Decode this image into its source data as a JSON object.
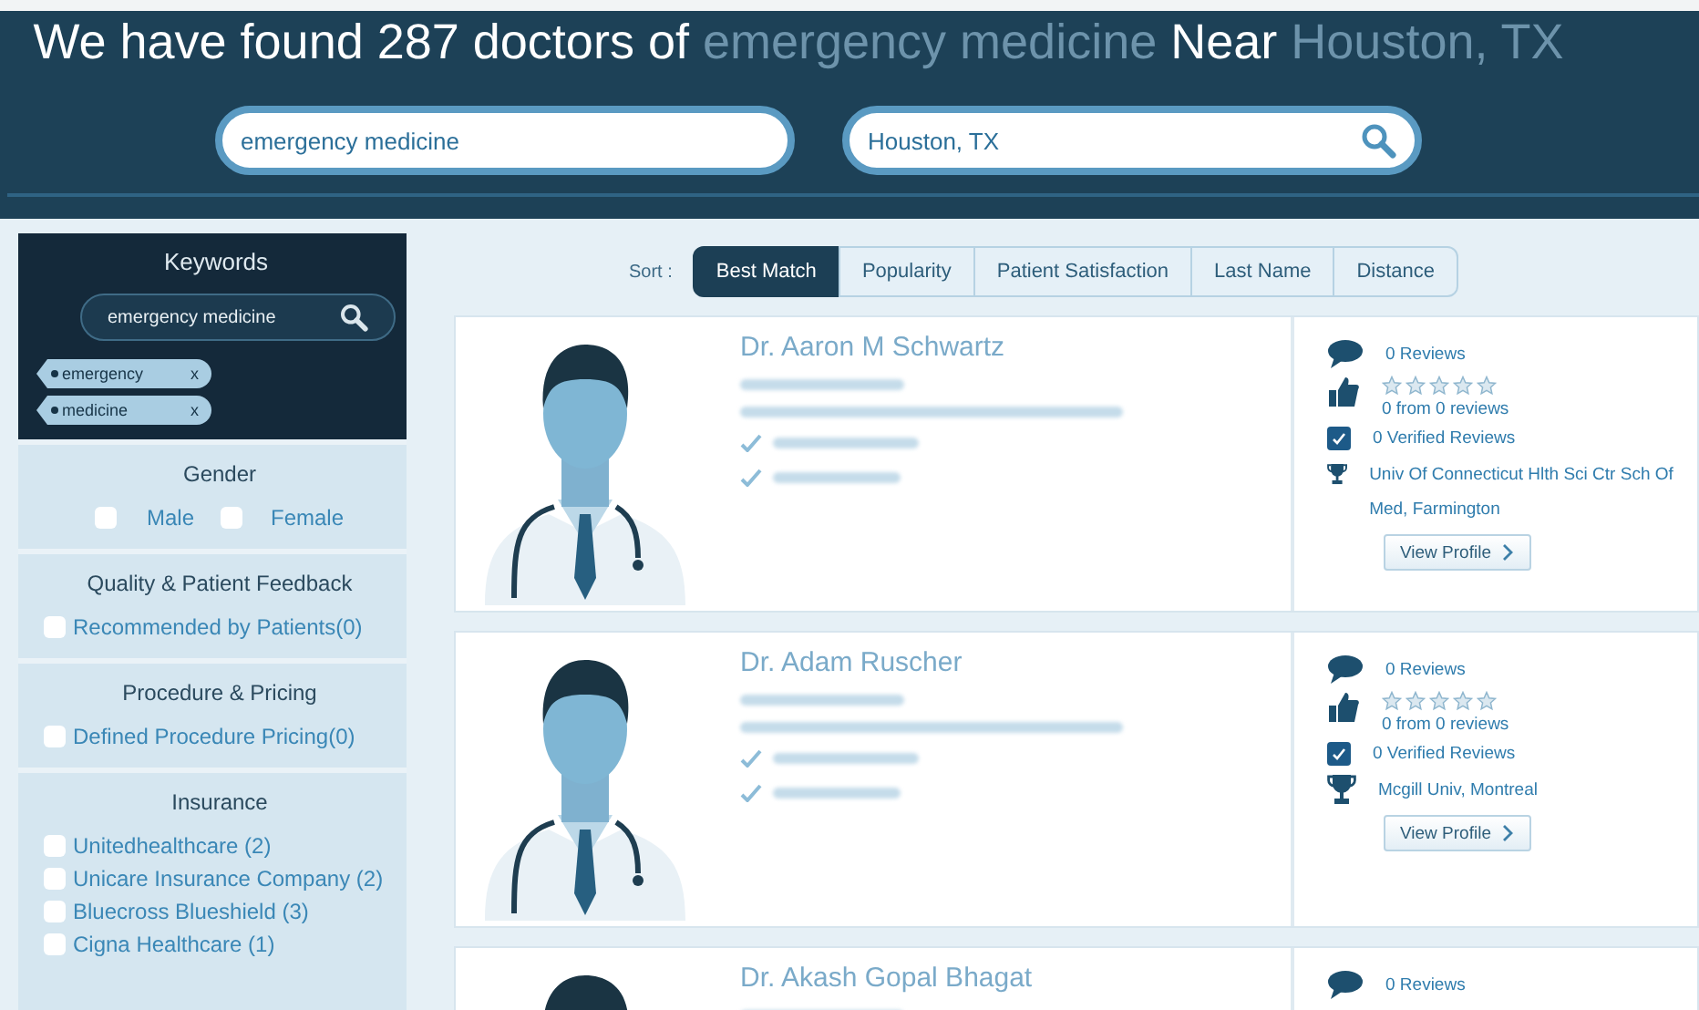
{
  "header": {
    "title_parts": [
      {
        "text": "We have found 287 doctors of",
        "kind": "plain"
      },
      {
        "text": "emergency medicine",
        "kind": "blurred"
      },
      {
        "text": "Near",
        "kind": "plain"
      },
      {
        "text": "Houston, TX",
        "kind": "blurred"
      }
    ],
    "specialty_field": {
      "value": "emergency medicine"
    },
    "location_field": {
      "value": "Houston, TX"
    }
  },
  "sidebar": {
    "keywords": {
      "title": "Keywords",
      "field": {
        "value": "emergency medicine"
      },
      "tags": [
        {
          "label": "emergency",
          "remove": "x"
        },
        {
          "label": "medicine",
          "remove": "x"
        }
      ]
    },
    "filters": [
      {
        "title": "Gender",
        "kind": "inline",
        "options": [
          {
            "label": "Male",
            "checked": false
          },
          {
            "label": "Female",
            "checked": false
          }
        ]
      },
      {
        "title": "Quality & Patient Feedback",
        "kind": "list",
        "options": [
          {
            "label": "Recommended by Patients(0)",
            "checked": false
          }
        ]
      },
      {
        "title": "Procedure & Pricing",
        "kind": "list",
        "options": [
          {
            "label": "Defined Procedure Pricing(0)",
            "checked": false
          }
        ]
      },
      {
        "title": "Insurance",
        "kind": "list",
        "options": [
          {
            "label": "Unitedhealthcare (2)",
            "checked": false
          },
          {
            "label": "Unicare Insurance Company (2)",
            "checked": false
          },
          {
            "label": "Bluecross Blueshield (3)",
            "checked": false
          },
          {
            "label": "Cigna Healthcare (1)",
            "checked": false
          }
        ]
      }
    ]
  },
  "sort": {
    "label": "Sort :",
    "options": [
      {
        "label": "Best Match",
        "selected": true
      },
      {
        "label": "Popularity",
        "selected": false
      },
      {
        "label": "Patient Satisfaction",
        "selected": false
      },
      {
        "label": "Last Name",
        "selected": false
      },
      {
        "label": "Distance",
        "selected": false
      }
    ]
  },
  "doctors": [
    {
      "name": "Dr. Aaron M Schwartz",
      "reviews": "0 Reviews",
      "stars": 0,
      "rating": "0 from 0 reviews",
      "verified": "0 Verified Reviews",
      "school": "Univ Of Connecticut Hlth Sci Ctr Sch Of Med, Farmington",
      "button": "View Profile"
    },
    {
      "name": "Dr. Adam Ruscher",
      "reviews": "0 Reviews",
      "stars": 0,
      "rating": "0 from 0 reviews",
      "verified": "0 Verified Reviews",
      "school": "Mcgill Univ, Montreal",
      "button": "View Profile"
    },
    {
      "name": "Dr. Akash Gopal Bhagat",
      "reviews": "0 Reviews"
    }
  ]
}
